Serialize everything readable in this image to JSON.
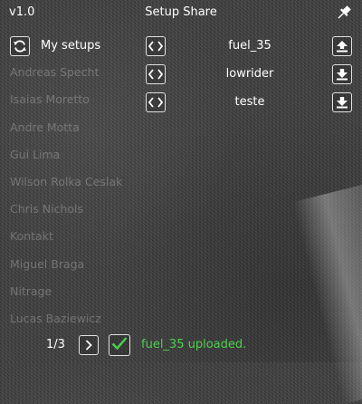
{
  "header": {
    "version": "v1.0",
    "title": "Setup Share",
    "pin_icon": "pin-icon"
  },
  "my_setups": {
    "refresh_icon": "refresh-icon",
    "label": "My setups"
  },
  "setups": [
    {
      "name": "fuel_35",
      "action_icon": "upload-icon"
    },
    {
      "name": "lowrider",
      "action_icon": "download-icon"
    },
    {
      "name": "teste",
      "action_icon": "download-icon"
    }
  ],
  "drivers": [
    "Andreas Specht",
    "Isaias Moretto",
    "Andre Motta",
    "Gui Lima",
    "Wilson Rolka Ceslak",
    "Chris Nichols",
    "Kontakt",
    "Miguel Braga",
    "Nitrage",
    "Lucas Baziewicz"
  ],
  "footer": {
    "page": "1/3",
    "next_icon": "chevron-right-icon",
    "status_icon": "check-icon",
    "status_message": "fuel_35 uploaded."
  },
  "colors": {
    "success": "#4cd04c",
    "text": "#ffffff",
    "driver_text_muted": "#d2d2d2"
  }
}
